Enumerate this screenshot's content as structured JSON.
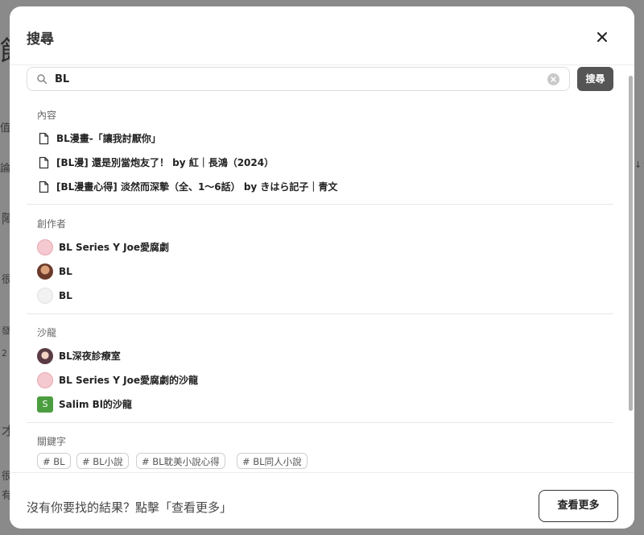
{
  "background": {
    "glyphs": [
      "館",
      "值",
      "論",
      "陣",
      "很",
      "發",
      "2",
      "才",
      "很",
      "有",
      "↓↑"
    ]
  },
  "modal": {
    "title": "搜尋",
    "close_icon": "close-icon"
  },
  "search": {
    "value": "BL",
    "button_label": "搜尋",
    "icon": "search-icon",
    "clear_icon": "clear-icon"
  },
  "sections": {
    "content": {
      "title": "內容",
      "items": [
        {
          "label": "BL漫畫-「讓我討厭你」",
          "icon": "document-icon"
        },
        {
          "label": "[BL漫] 還是別當炮友了！ by 紅｜長鴻（2024）",
          "icon": "document-icon"
        },
        {
          "label": "[BL漫畫心得] 淡然而深摯（全、1～6話） by きはら記子｜青文",
          "icon": "document-icon"
        }
      ]
    },
    "creators": {
      "title": "創作者",
      "items": [
        {
          "label": "BL Series Y Joe愛腐劇"
        },
        {
          "label": "BL"
        },
        {
          "label": "BL"
        }
      ]
    },
    "salons": {
      "title": "沙龍",
      "items": [
        {
          "label": "BL深夜診療室"
        },
        {
          "label": "BL Series Y Joe愛腐劇的沙龍"
        },
        {
          "label": "Salim Bl的沙龍",
          "avatar_letter": "S"
        }
      ]
    },
    "keywords": {
      "title": "關鍵字",
      "tags": [
        "# BL",
        "# BL小說",
        "# BL耽美小說心得",
        "# BL同人小說"
      ]
    }
  },
  "footer": {
    "text": "沒有你要找的結果？點擊「查看更多」",
    "button_label": "查看更多"
  },
  "colors": {
    "search_button_bg": "#555555",
    "salon_avatar_green": "#4b9e3f",
    "backdrop": "#8a8a8a"
  }
}
